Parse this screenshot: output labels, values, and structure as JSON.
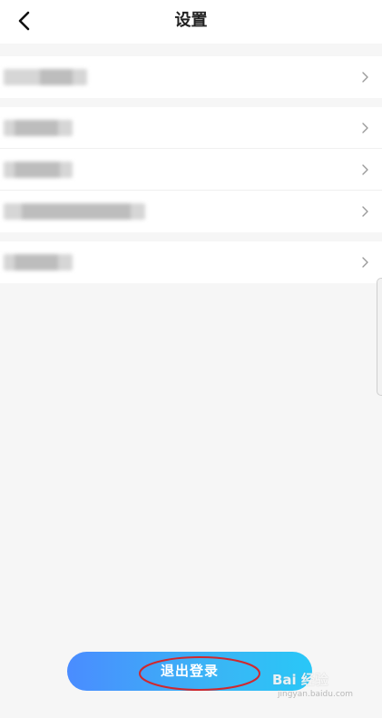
{
  "header": {
    "title": "设置",
    "back_icon": "chevron-left-icon"
  },
  "groups": [
    {
      "rows": [
        {
          "label_hidden": "blurred text"
        }
      ]
    },
    {
      "rows": [
        {
          "label_hidden": "blurred text"
        },
        {
          "label_hidden": "blurred text"
        },
        {
          "label_hidden": "blurred text"
        }
      ]
    },
    {
      "rows": [
        {
          "label_hidden": "blurred text"
        }
      ]
    }
  ],
  "row_icon": "chevron-right-icon",
  "logout": {
    "label": "退出登录",
    "colors": {
      "start": "#4a8cff",
      "end": "#29c7f7"
    }
  },
  "annotation": {
    "color": "#d0282e"
  },
  "watermark": {
    "text": "Bai 经验",
    "sub": "jingyan.baidu.com"
  }
}
